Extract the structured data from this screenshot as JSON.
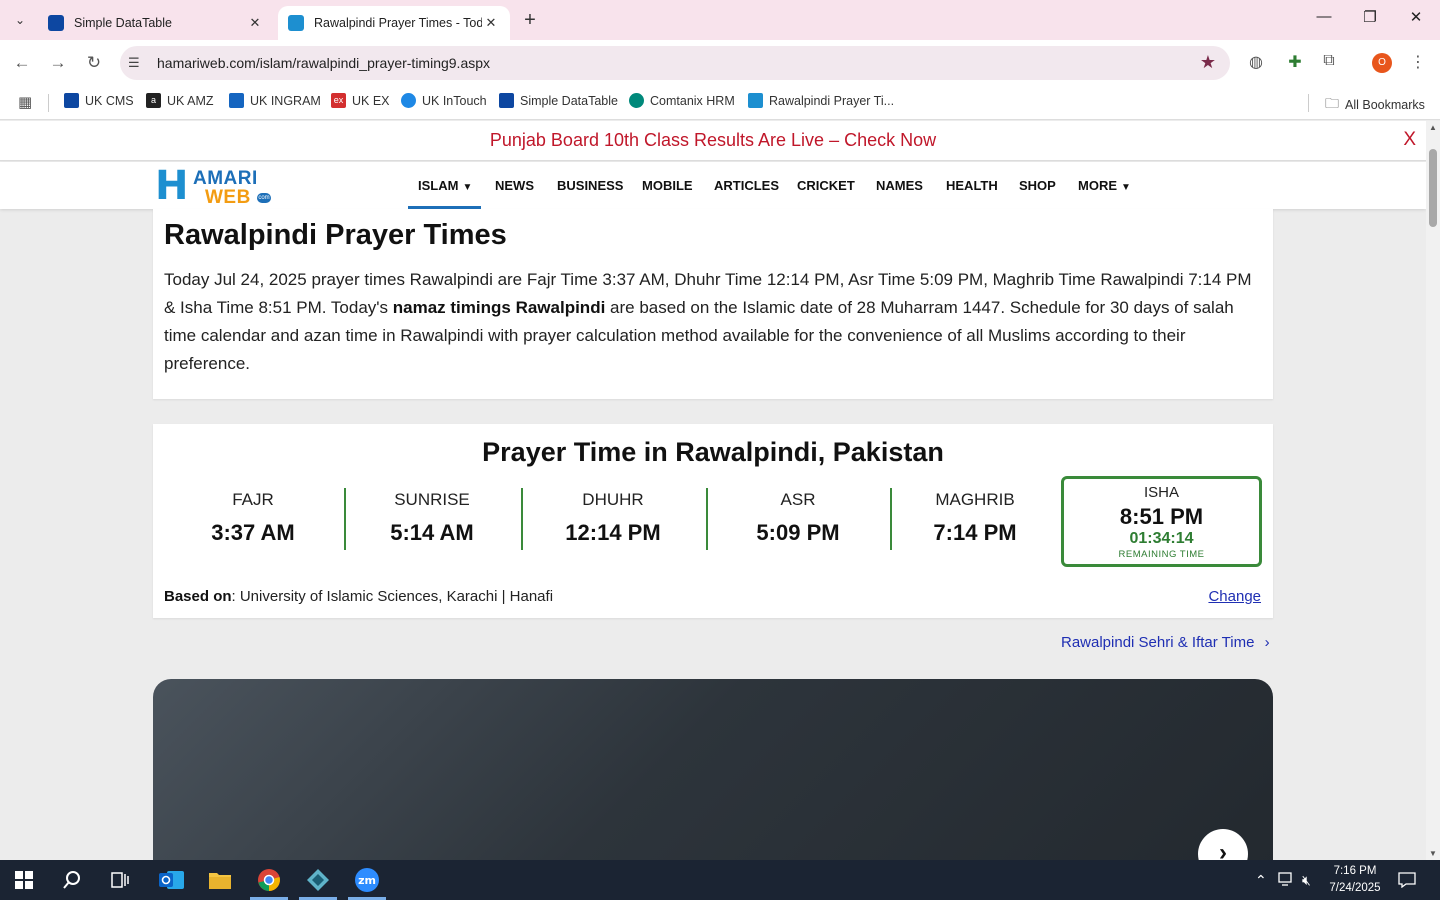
{
  "browser": {
    "tabs": [
      {
        "title": "Simple DataTable",
        "active": false
      },
      {
        "title": "Rawalpindi Prayer Times - Toda",
        "active": true
      }
    ],
    "url": "hamariweb.com/islam/rawalpindi_prayer-timing9.aspx",
    "profile_initial": "O",
    "bookmarks": [
      {
        "label": "UK CMS",
        "icon_color": "#0d47a1"
      },
      {
        "label": "UK AMZ",
        "icon_color": "#222222"
      },
      {
        "label": "UK INGRAM",
        "icon_color": "#1565c0"
      },
      {
        "label": "UK EX",
        "icon_color": "#d32f2f"
      },
      {
        "label": "UK InTouch",
        "icon_color": "#1e88e5"
      },
      {
        "label": "Simple DataTable",
        "icon_color": "#0d47a1"
      },
      {
        "label": "Comtanix HRM",
        "icon_color": "#00897b"
      },
      {
        "label": "Rawalpindi Prayer Ti...",
        "icon_color": "#1d8fd0"
      }
    ],
    "all_bookmarks": "All Bookmarks"
  },
  "page": {
    "promo": {
      "text": "Punjab Board 10th Class Results Are Live – Check Now",
      "close": "X"
    },
    "logo": {
      "amari": "AMARI",
      "web": "WEB",
      "com": "com"
    },
    "nav": [
      {
        "label": "ISLAM",
        "dropdown": true
      },
      {
        "label": "NEWS"
      },
      {
        "label": "BUSINESS"
      },
      {
        "label": "MOBILE"
      },
      {
        "label": "ARTICLES"
      },
      {
        "label": "CRICKET"
      },
      {
        "label": "NAMES"
      },
      {
        "label": "HEALTH"
      },
      {
        "label": "SHOP"
      },
      {
        "label": "MORE",
        "dropdown": true
      }
    ],
    "title": "Rawalpindi Prayer Times",
    "intro_part1": "Today Jul 24, 2025 prayer times Rawalpindi are Fajr Time 3:37 AM, Dhuhr Time 12:14 PM, Asr Time 5:09 PM, Maghrib Time Rawalpindi 7:14 PM & Isha Time 8:51 PM. Today's ",
    "intro_bold": "namaz timings Rawalpindi",
    "intro_part2": " are based on the Islamic date of 28 Muharram 1447. Schedule for 30 days of salah time calendar and azan time in Rawalpindi with prayer calculation method available for the convenience of all Muslims according to their preference.",
    "prayer_heading": "Prayer Time in Rawalpindi, Pakistan",
    "prayers": [
      {
        "name": "FAJR",
        "time": "3:37 AM"
      },
      {
        "name": "SUNRISE",
        "time": "5:14 AM"
      },
      {
        "name": "DHUHR",
        "time": "12:14 PM"
      },
      {
        "name": "ASR",
        "time": "5:09 PM"
      },
      {
        "name": "MAGHRIB",
        "time": "7:14 PM"
      }
    ],
    "current_prayer": {
      "name": "ISHA",
      "time": "8:51 PM",
      "remaining": "01:34:14",
      "remaining_label": "REMAINING TIME"
    },
    "based_on_label": "Based on",
    "based_on_value": ": University of Islamic Sciences, Karachi | Hanafi",
    "change_link": "Change",
    "sehri_link": "Rawalpindi Sehri & Iftar Time",
    "accent_color": "#3a8a3a",
    "link_color": "#1f2fb3"
  },
  "taskbar": {
    "time": "7:16 PM",
    "date": "7/24/2025"
  }
}
